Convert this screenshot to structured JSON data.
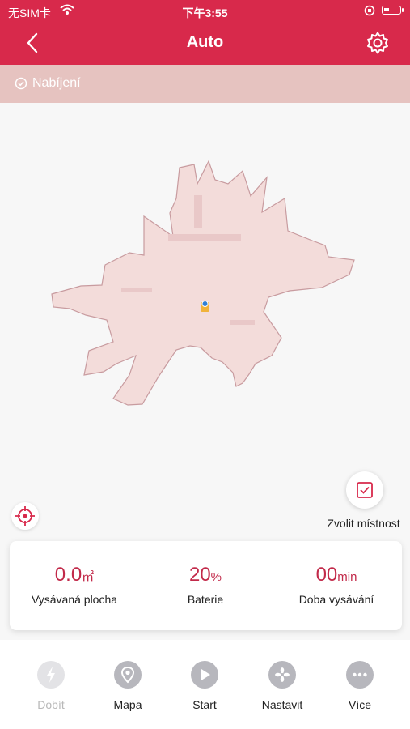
{
  "status_bar": {
    "carrier": "无SIM卡",
    "time": "下午3:55"
  },
  "header": {
    "title": "Auto",
    "back_icon": "chevron-left-icon",
    "settings_icon": "gear-icon"
  },
  "charging": {
    "label": "Nabíjení",
    "icon": "check-circle-icon"
  },
  "map": {
    "room_button_label": "Zvolit místnost",
    "locate_icon": "crosshair-icon",
    "room_icon": "checkbox-icon",
    "colors": {
      "explored": "#f3dcda",
      "walls": "#c89b9f",
      "robot": "#2f7fd6",
      "dock": "#f0b33a"
    }
  },
  "stats": [
    {
      "value": "0.0",
      "unit": "㎡",
      "label": "Vysávaná plocha"
    },
    {
      "value": "20",
      "unit": "%",
      "label": "Baterie"
    },
    {
      "value": "00",
      "unit": "min",
      "label": "Doba vysávání"
    }
  ],
  "tabs": [
    {
      "label": "Dobít",
      "icon": "lightning-icon",
      "enabled": false
    },
    {
      "label": "Mapa",
      "icon": "location-pin-icon",
      "enabled": true
    },
    {
      "label": "Start",
      "icon": "play-icon",
      "enabled": true
    },
    {
      "label": "Nastavit",
      "icon": "fan-icon",
      "enabled": true
    },
    {
      "label": "Více",
      "icon": "more-icon",
      "enabled": true
    }
  ],
  "colors": {
    "header": "#d8294b",
    "charge_bar": "#e6c3c0",
    "accent_text": "#c22a4a",
    "icon_gray": "#b7b7bd"
  }
}
